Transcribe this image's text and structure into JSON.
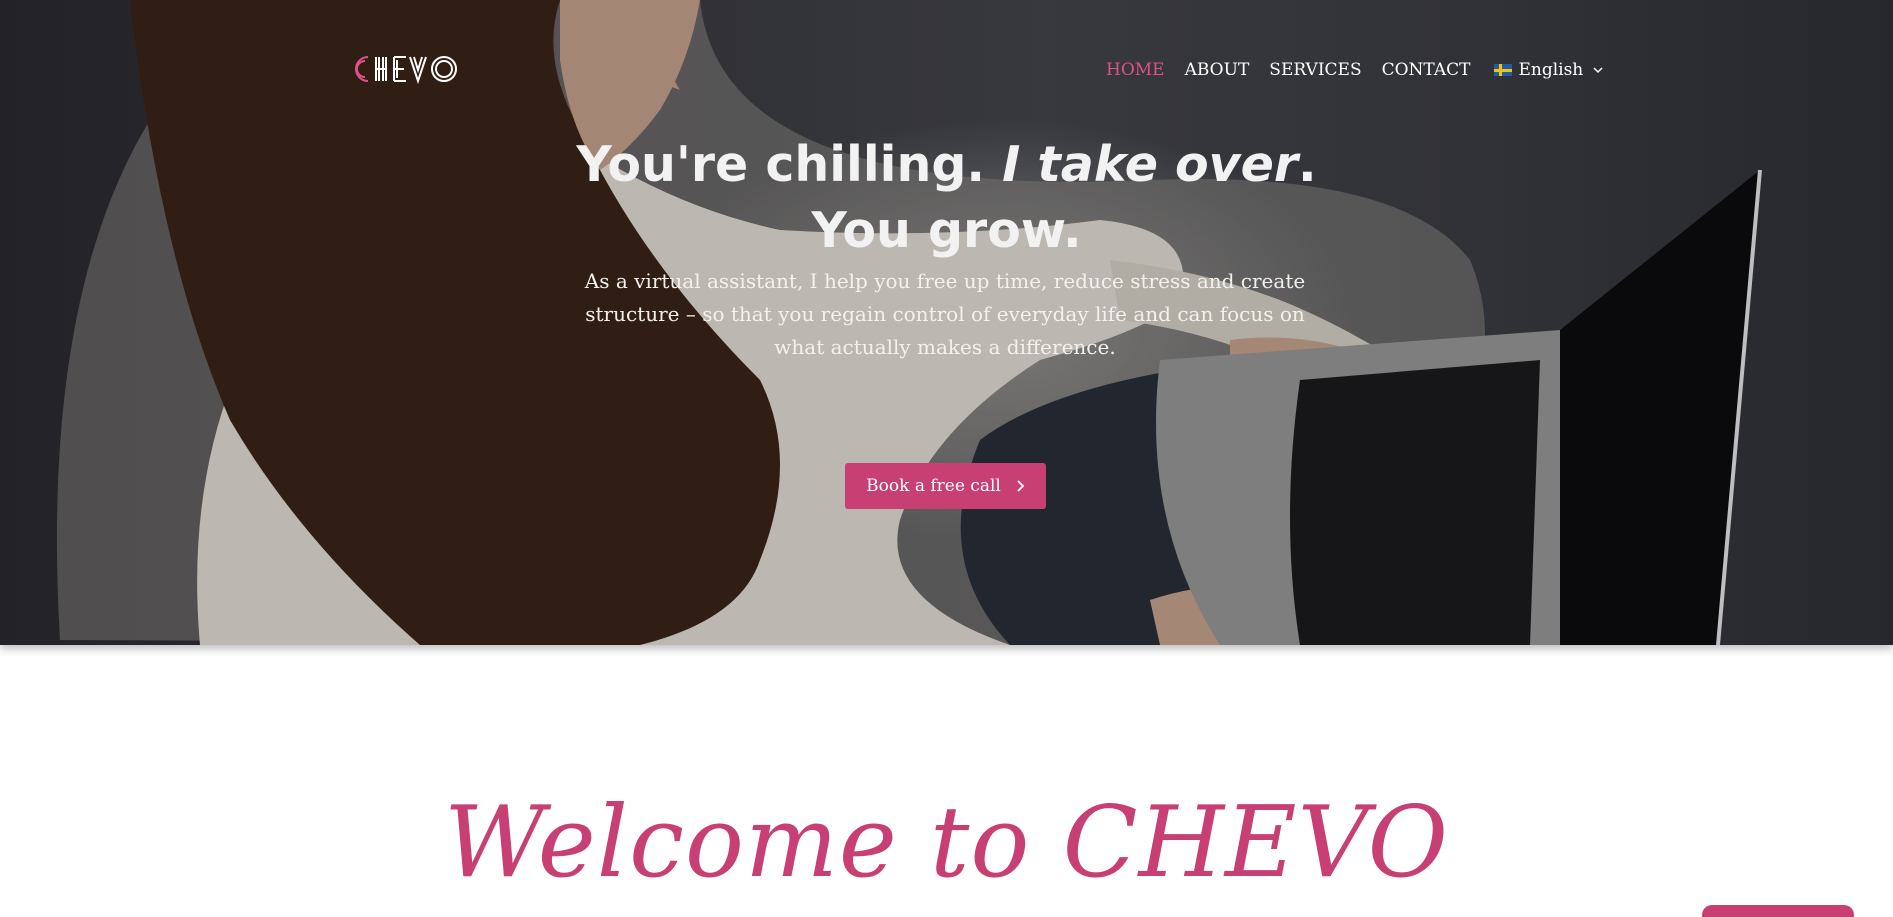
{
  "brand": {
    "logo_text": "CHEVO",
    "accent": "#c83f74"
  },
  "nav": {
    "items": [
      {
        "label": "HOME",
        "active": true
      },
      {
        "label": "ABOUT",
        "active": false
      },
      {
        "label": "SERVICES",
        "active": false
      },
      {
        "label": "CONTACT",
        "active": false
      }
    ],
    "language": {
      "label": "English",
      "flag": "sweden-flag-icon"
    }
  },
  "hero": {
    "headline_part1": "You're chilling.",
    "headline_italic": "I take over",
    "headline_period": ".",
    "headline_line2": "You grow.",
    "subtext": "As a virtual assistant, I help you free up time, reduce stress and create structure – so that you regain control of everyday life and can focus on what actually makes a difference.",
    "cta_label": "Book a free call"
  },
  "welcome": {
    "title": "Welcome to CHEVO"
  }
}
